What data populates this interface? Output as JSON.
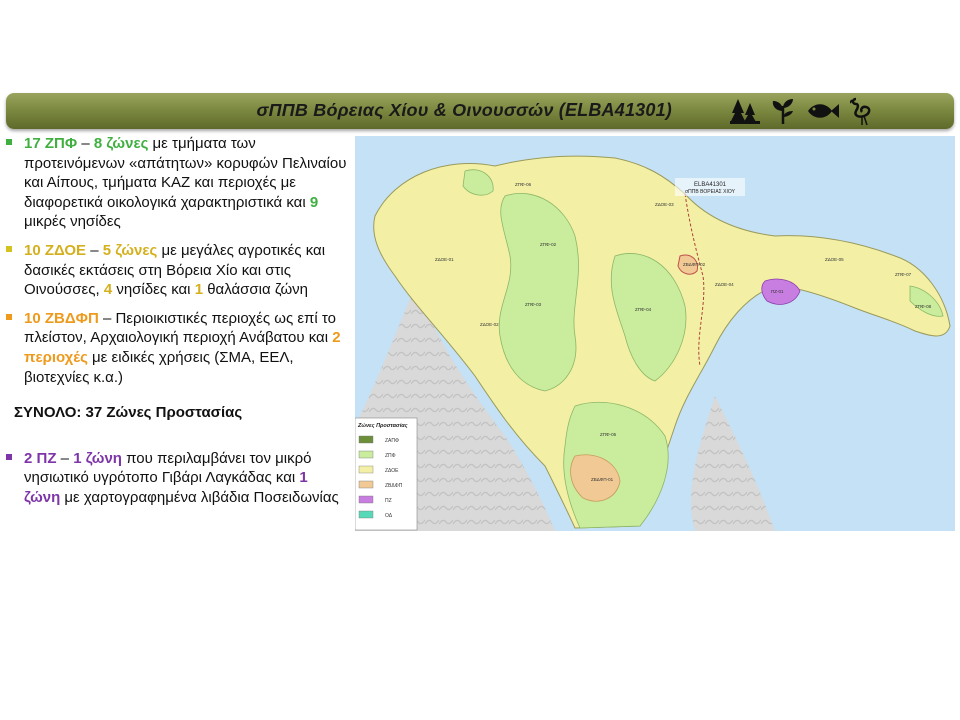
{
  "banner": {
    "title": "σΠΠΒ Βόρειας Χίου & Οινουσσών (ELBA41301)",
    "icons": [
      "trees-icon",
      "plant-icon",
      "fish-icon",
      "flamingo-icon"
    ]
  },
  "bullets": {
    "b1": {
      "count": "17 ΖΠΦ",
      "dash": " – ",
      "zones": "8 ζώνες",
      "t1": " με τμήματα των προτεινόμενων «απάτητων» κορυφών Πελιναίου και Αίπους, τμήματα ΚΑΖ και περιοχές με διαφορετικά οικολογικά χαρακτηριστικά και ",
      "n": "9",
      "t2": " μικρές νησίδες"
    },
    "b2": {
      "count": "10 ΖΔΟΕ",
      "dash": " – ",
      "zones": "5 ζώνες",
      "t1": " με μεγάλες αγροτικές και δασικές εκτάσεις στη Βόρεια Χίο και στις Οινούσσες, ",
      "n1": "4",
      "t2": " νησίδες και ",
      "n2": "1",
      "t3": " θαλάσσια ζώνη"
    },
    "b3": {
      "count": "10 ΖΒΔΦΠ",
      "dash": " – ",
      "t1": "Περιοικιστικές περιοχές ως επί το πλείστον, Αρχαιολογική περιοχή Ανάβατου και ",
      "areas": "2 περιοχές",
      "t2": " με ειδικές χρήσεις (ΣΜΑ, ΕΕΛ, βιοτεχνίες κ.α.)"
    },
    "total": "ΣΥΝΟΛΟ: 37 Ζώνες Προστασίας",
    "b4": {
      "count": "2 ΠΖ",
      "dash": " – ",
      "zone1": "1 ζώνη",
      "t1": " που περιλαμβάνει τον μικρό νησιωτικό υγρότοπο Γιβάρι Λαγκάδας και ",
      "zone2a": "1",
      "t2": " ",
      "zone2b": "ζώνη",
      "t3": " με χαρτογραφημένα λιβάδια Ποσειδωνίας"
    }
  },
  "colors": {
    "green": "#3fb040",
    "yellow": "#d4b01e",
    "orange": "#ee9a1c",
    "purple": "#7d35a8"
  },
  "map": {
    "caption_line1": "ELBA41301",
    "caption_line2": "σΠΠΒ ΒΟΡΕΙΑΣ ΧΙΟΥ",
    "legend_title": "Ζώνες Προστασίας",
    "legend": [
      {
        "label": "ΖΑΠΦ",
        "color": "#6d8f3a"
      },
      {
        "label": "ΖΠΦ",
        "color": "#c9ec9d"
      },
      {
        "label": "ΖΔΟΕ",
        "color": "#f3f0a6"
      },
      {
        "label": "ΖΒΔΦΠ",
        "color": "#f0c994"
      },
      {
        "label": "ΠΖ",
        "color": "#c77ee0"
      },
      {
        "label": "ΟΔ",
        "color": "#57d9b8"
      }
    ],
    "zone_labels": [
      "ΖΠΦ-06",
      "ΖΠΦ-02",
      "ΖΔΟΕ-01",
      "ΖΠΦ-03",
      "ΖΔΟΕ-02",
      "ΖΠΦ-04",
      "ΖΠΦ-05",
      "ΖΔΟΕ-03",
      "ΖΒΔΦΠ-01",
      "ΖΒΔΦΠ-02",
      "ΖΔΟΕ-04",
      "ΠΖ-01",
      "ΖΔΟΕ-05",
      "ΖΠΦ-07",
      "ΖΠΦ-08"
    ]
  }
}
